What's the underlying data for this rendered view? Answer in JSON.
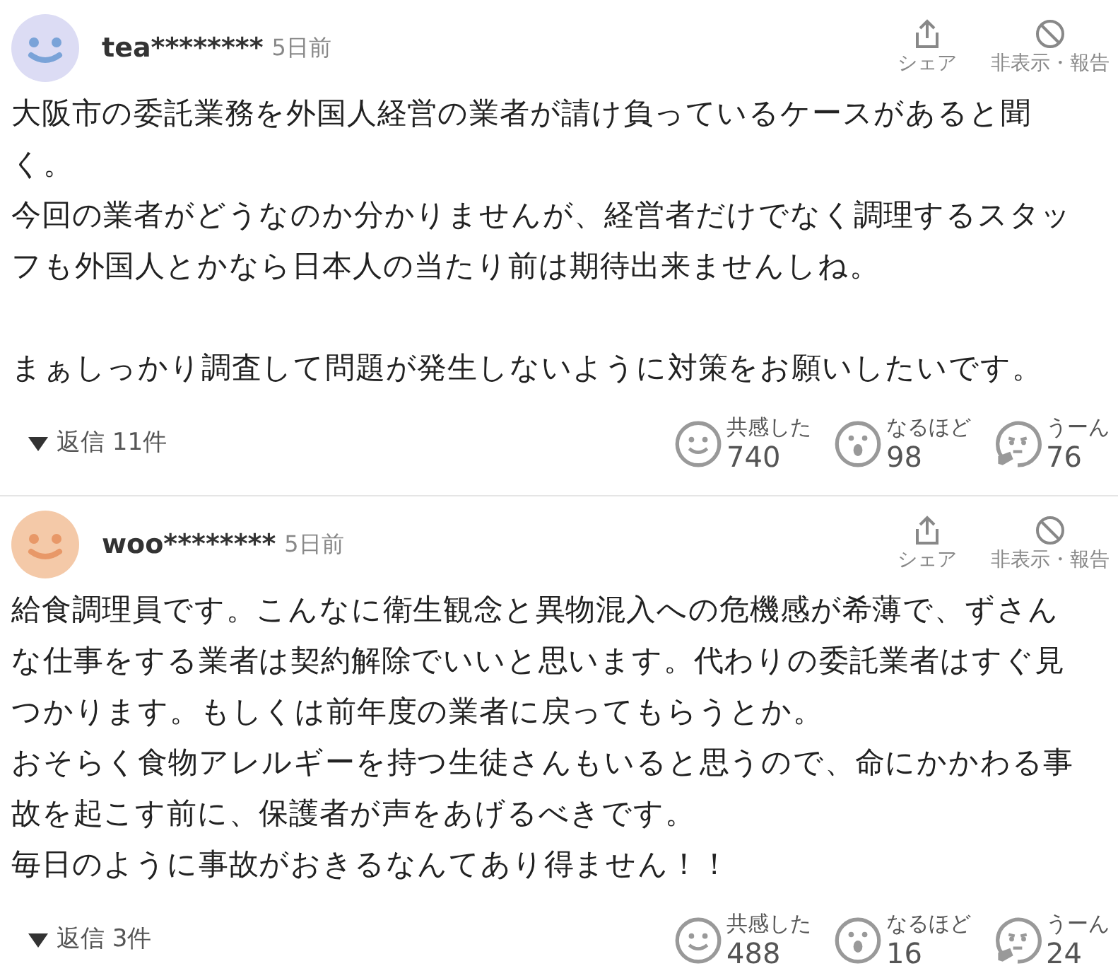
{
  "comments": [
    {
      "user": "tea********",
      "time": "5日前",
      "color": "#dcdcf4",
      "share": "シェア",
      "hide": "非表示・報告",
      "body": [
        [
          "大阪市の委託業務を外国人経営の業者が請け負っているケースがあると聞",
          "く。",
          "今回の業者がどうなのか分かりませんが、経営者だけでなく調理するスタッ",
          "フも外国人とかなら日本人の当たり前は期待出来ませんしね。"
        ],
        [
          "まぁしっかり調査して問題が発生しないように対策をお願いしたいです。"
        ]
      ],
      "replies": "返信 11件",
      "reactions": [
        {
          "kind": "empathy",
          "label": "共感した",
          "count": "740"
        },
        {
          "kind": "understand",
          "label": "なるほど",
          "count": "98"
        },
        {
          "kind": "hmm",
          "label": "うーん",
          "count": "76"
        }
      ]
    },
    {
      "user": "woo********",
      "time": "5日前",
      "color": "#f4c9a8",
      "share": "シェア",
      "hide": "非表示・報告",
      "body": [
        [
          "給食調理員です。こんなに衛生観念と異物混入への危機感が希薄で、ずさん",
          "な仕事をする業者は契約解除でいいと思います。代わりの委託業者はすぐ見",
          "つかります。もしくは前年度の業者に戻ってもらうとか。",
          "おそらく食物アレルギーを持つ生徒さんもいると思うので、命にかかわる事",
          "故を起こす前に、保護者が声をあげるべきです。",
          "毎日のように事故がおきるなんてあり得ません！！"
        ]
      ],
      "replies": "返信 3件",
      "reactions": [
        {
          "kind": "empathy",
          "label": "共感した",
          "count": "488"
        },
        {
          "kind": "understand",
          "label": "なるほど",
          "count": "16"
        },
        {
          "kind": "hmm",
          "label": "うーん",
          "count": "24"
        }
      ]
    }
  ]
}
